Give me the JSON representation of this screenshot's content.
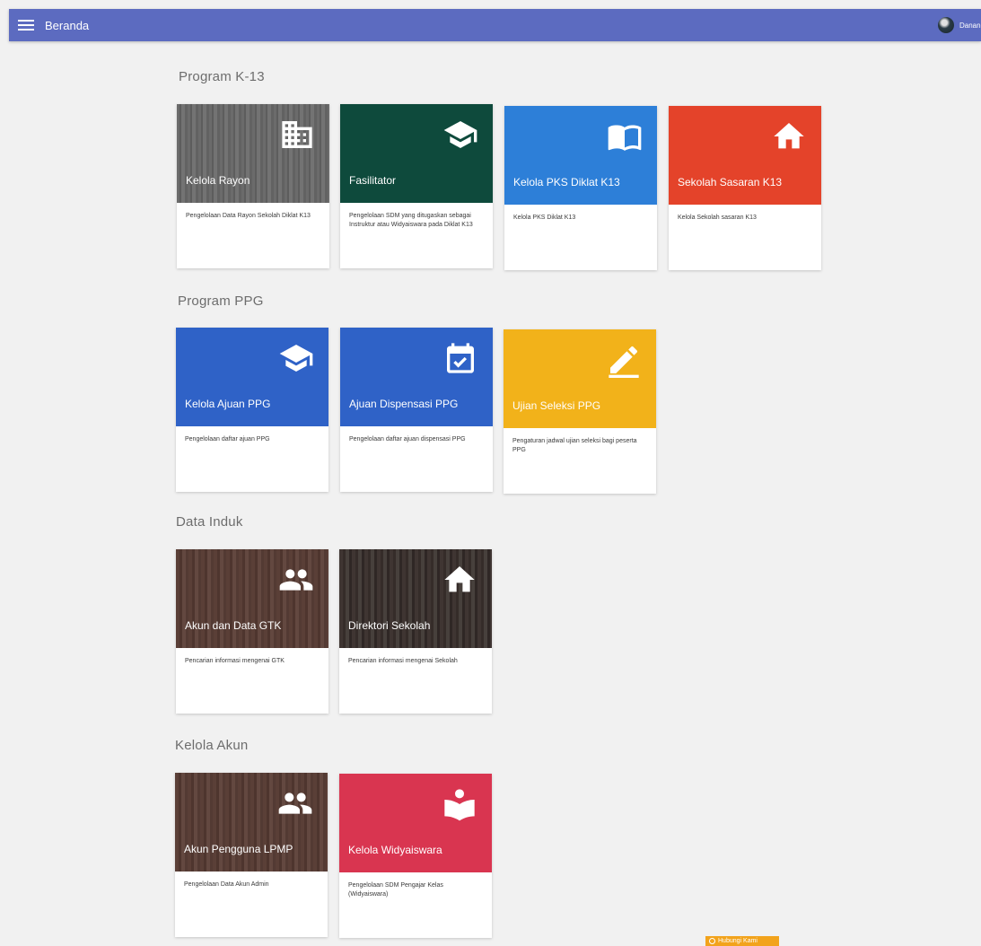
{
  "header": {
    "title": "Beranda",
    "user_name": "Danang"
  },
  "sections": [
    {
      "title": "Program K-13",
      "cards": [
        {
          "title": "Kelola Rayon",
          "desc": "Pengelolaan Data Rayon Sekolah Diklat K13",
          "icon": "building-icon",
          "color": "#6b6b6b"
        },
        {
          "title": "Fasilitator",
          "desc": "Pengelolaan SDM yang ditugaskan sebagai Instruktur atau Widyaiswara pada Diklat K13",
          "icon": "graduation-cap-icon",
          "color": "#0e4a3c"
        },
        {
          "title": "Kelola PKS Diklat K13",
          "desc": "Kelola PKS Diklat K13",
          "icon": "book-icon",
          "color": "#2d7fd8"
        },
        {
          "title": "Sekolah Sasaran K13",
          "desc": "Kelola Sekolah sasaran K13",
          "icon": "home-icon",
          "color": "#e4432a"
        }
      ]
    },
    {
      "title": "Program PPG",
      "cards": [
        {
          "title": "Kelola Ajuan PPG",
          "desc": "Pengelolaan daftar ajuan PPG",
          "icon": "graduation-cap-icon",
          "color": "#2f62c7"
        },
        {
          "title": "Ajuan Dispensasi PPG",
          "desc": "Pengelolaan daftar ajuan dispensasi PPG",
          "icon": "calendar-check-icon",
          "color": "#2f62c7"
        },
        {
          "title": "Ujian Seleksi PPG",
          "desc": "Pengaturan jadwal ujian seleksi bagi peserta PPG",
          "icon": "pencil-icon",
          "color": "#f2b21a"
        }
      ]
    },
    {
      "title": "Data Induk",
      "cards": [
        {
          "title": "Akun dan Data GTK",
          "desc": "Pencarian informasi mengenai GTK",
          "icon": "people-icon",
          "color": "#5a3f37"
        },
        {
          "title": "Direktori Sekolah",
          "desc": "Pencarian informasi mengenai Sekolah",
          "icon": "home-icon",
          "color": "#3f3532"
        }
      ]
    },
    {
      "title": "Kelola Akun",
      "cards": [
        {
          "title": "Akun Pengguna LPMP",
          "desc": "Pengelolaan Data Akun Admin",
          "icon": "people-icon",
          "color": "#5a3f37"
        },
        {
          "title": "Kelola Widyaiswara",
          "desc": "Pengelolaan SDM Pengajar Kelas (Widyaiswara)",
          "icon": "reader-icon",
          "color": "#d93550"
        }
      ]
    }
  ],
  "help_button": {
    "label": "Hubungi Kami"
  }
}
